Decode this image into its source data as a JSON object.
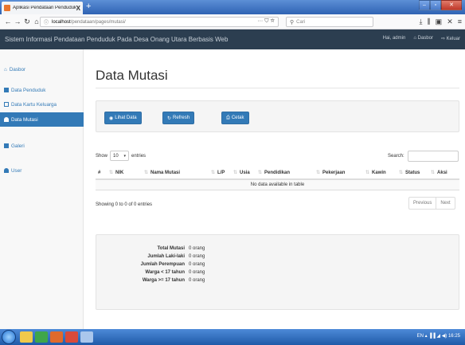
{
  "browser": {
    "tab_title": "Aplikasi Pendataan Penduduk",
    "tab_close": "X",
    "new_tab": "+",
    "url_host": "localhost",
    "url_path": "/pendataan/pages/mutasi/",
    "url_actions": "··· ⛉ ☆",
    "search_placeholder": "Cari",
    "toolbar_icons": [
      "download-icon",
      "library-icon",
      "sidebar-icon",
      "close-icon",
      "menu-icon"
    ]
  },
  "app": {
    "title": "Sistem Informasi Pendataan Penduduk Pada Desa Onang Utara Berbasis Web",
    "greeting": "Hai, admin",
    "nav_dasbor": "Dasbor",
    "nav_keluar": "Keluar"
  },
  "sidebar": {
    "items": [
      {
        "label": "Dasbor",
        "icon": "home-icon"
      },
      {
        "label": "Data Penduduk",
        "icon": "book-icon"
      },
      {
        "label": "Data Kartu Keluarga",
        "icon": "card-icon"
      },
      {
        "label": "Data Mutasi",
        "icon": "user-move-icon"
      },
      {
        "label": "Galeri",
        "icon": "picture-icon"
      },
      {
        "label": "User",
        "icon": "user-icon"
      }
    ],
    "active_index": 3
  },
  "main": {
    "title": "Data Mutasi",
    "buttons": {
      "lihat": "Lihat Data",
      "refresh": "Refresh",
      "cetak": "Cetak"
    },
    "show_label": "Show",
    "show_value": "10",
    "entries_label": "entries",
    "search_label": "Search:",
    "columns": [
      "#",
      "NIK",
      "Nama Mutasi",
      "L/P",
      "Usia",
      "Pendidikan",
      "Pekerjaan",
      "Kawin",
      "Status",
      "Aksi"
    ],
    "empty_text": "No data available in table",
    "info_text": "Showing 0 to 0 of 0 entries",
    "pager": {
      "previous": "Previous",
      "next": "Next"
    }
  },
  "summary": [
    {
      "label": "Total Mutasi",
      "value": "0 orang"
    },
    {
      "label": "Jumlah Laki-laki",
      "value": "0 orang"
    },
    {
      "label": "Jumlah Perempuan",
      "value": "0 orang"
    },
    {
      "label": "Warga < 17 tahun",
      "value": "0 orang"
    },
    {
      "label": "Warga >= 17 tahun",
      "value": "0 orang"
    }
  ],
  "taskbar": {
    "tray_text": "EN  ▴  ▐▐  ◢  ◀)  16:25"
  },
  "colors": {
    "accent": "#337ab7",
    "header": "#2c3e50"
  }
}
